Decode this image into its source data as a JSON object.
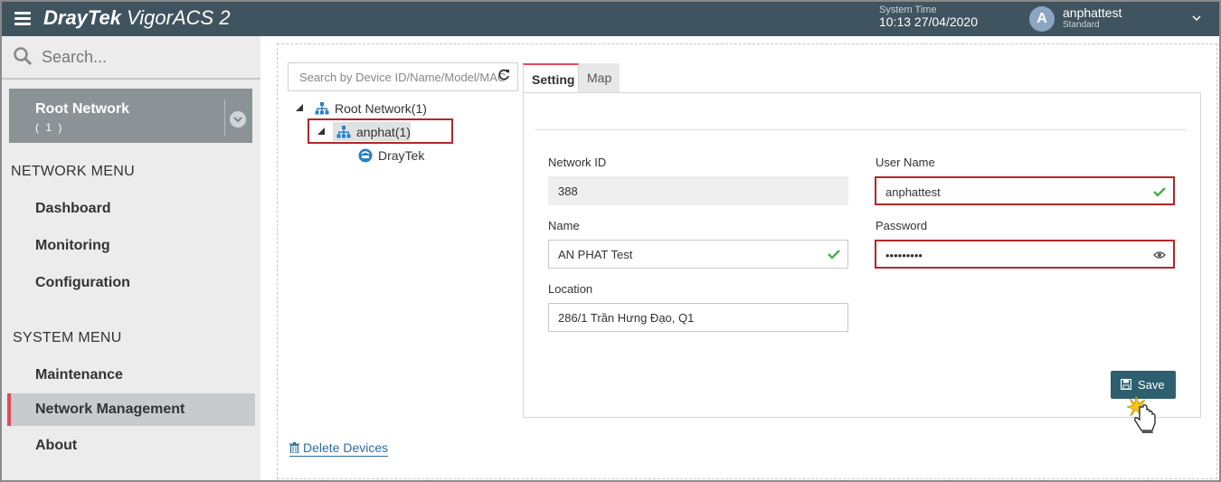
{
  "header": {
    "brand_primary": "DrayTek",
    "brand_secondary": "VigorACS 2",
    "system_time_label": "System Time",
    "system_time_value": "10:13 27/04/2020",
    "avatar_letter": "A",
    "user_name": "anphattest",
    "user_role": "Standard"
  },
  "sidebar": {
    "search_placeholder": "Search...",
    "root_network": {
      "name": "Root Network",
      "count": "( 1 )"
    },
    "network_menu_title": "NETWORK MENU",
    "network_menu": [
      "Dashboard",
      "Monitoring",
      "Configuration"
    ],
    "system_menu_title": "SYSTEM MENU",
    "system_menu": [
      "Maintenance",
      "Network Management",
      "About"
    ],
    "active_item": "Network Management"
  },
  "tree": {
    "search_placeholder": "Search by Device ID/Name/Model/MAC",
    "root": "Root Network(1)",
    "child": "anphat(1)",
    "device": "DrayTek"
  },
  "tabs": [
    "Setting",
    "Map"
  ],
  "form": {
    "network_id_label": "Network ID",
    "network_id_value": "388",
    "name_label": "Name",
    "name_value": "AN PHAT Test",
    "location_label": "Location",
    "location_value": "286/1 Trần Hưng Đạo, Q1",
    "user_name_label": "User Name",
    "user_name_value": "anphattest",
    "password_label": "Password",
    "password_value": "•••••••••"
  },
  "actions": {
    "save_label": "Save",
    "delete_label": "Delete Devices"
  },
  "colors": {
    "header_bg": "#3f545e",
    "accent_red": "#e24a5a",
    "error_border": "#b3262b",
    "save_button": "#2d5f6e",
    "tree_icon": "#2a80c8",
    "valid_check": "#4caf50"
  }
}
